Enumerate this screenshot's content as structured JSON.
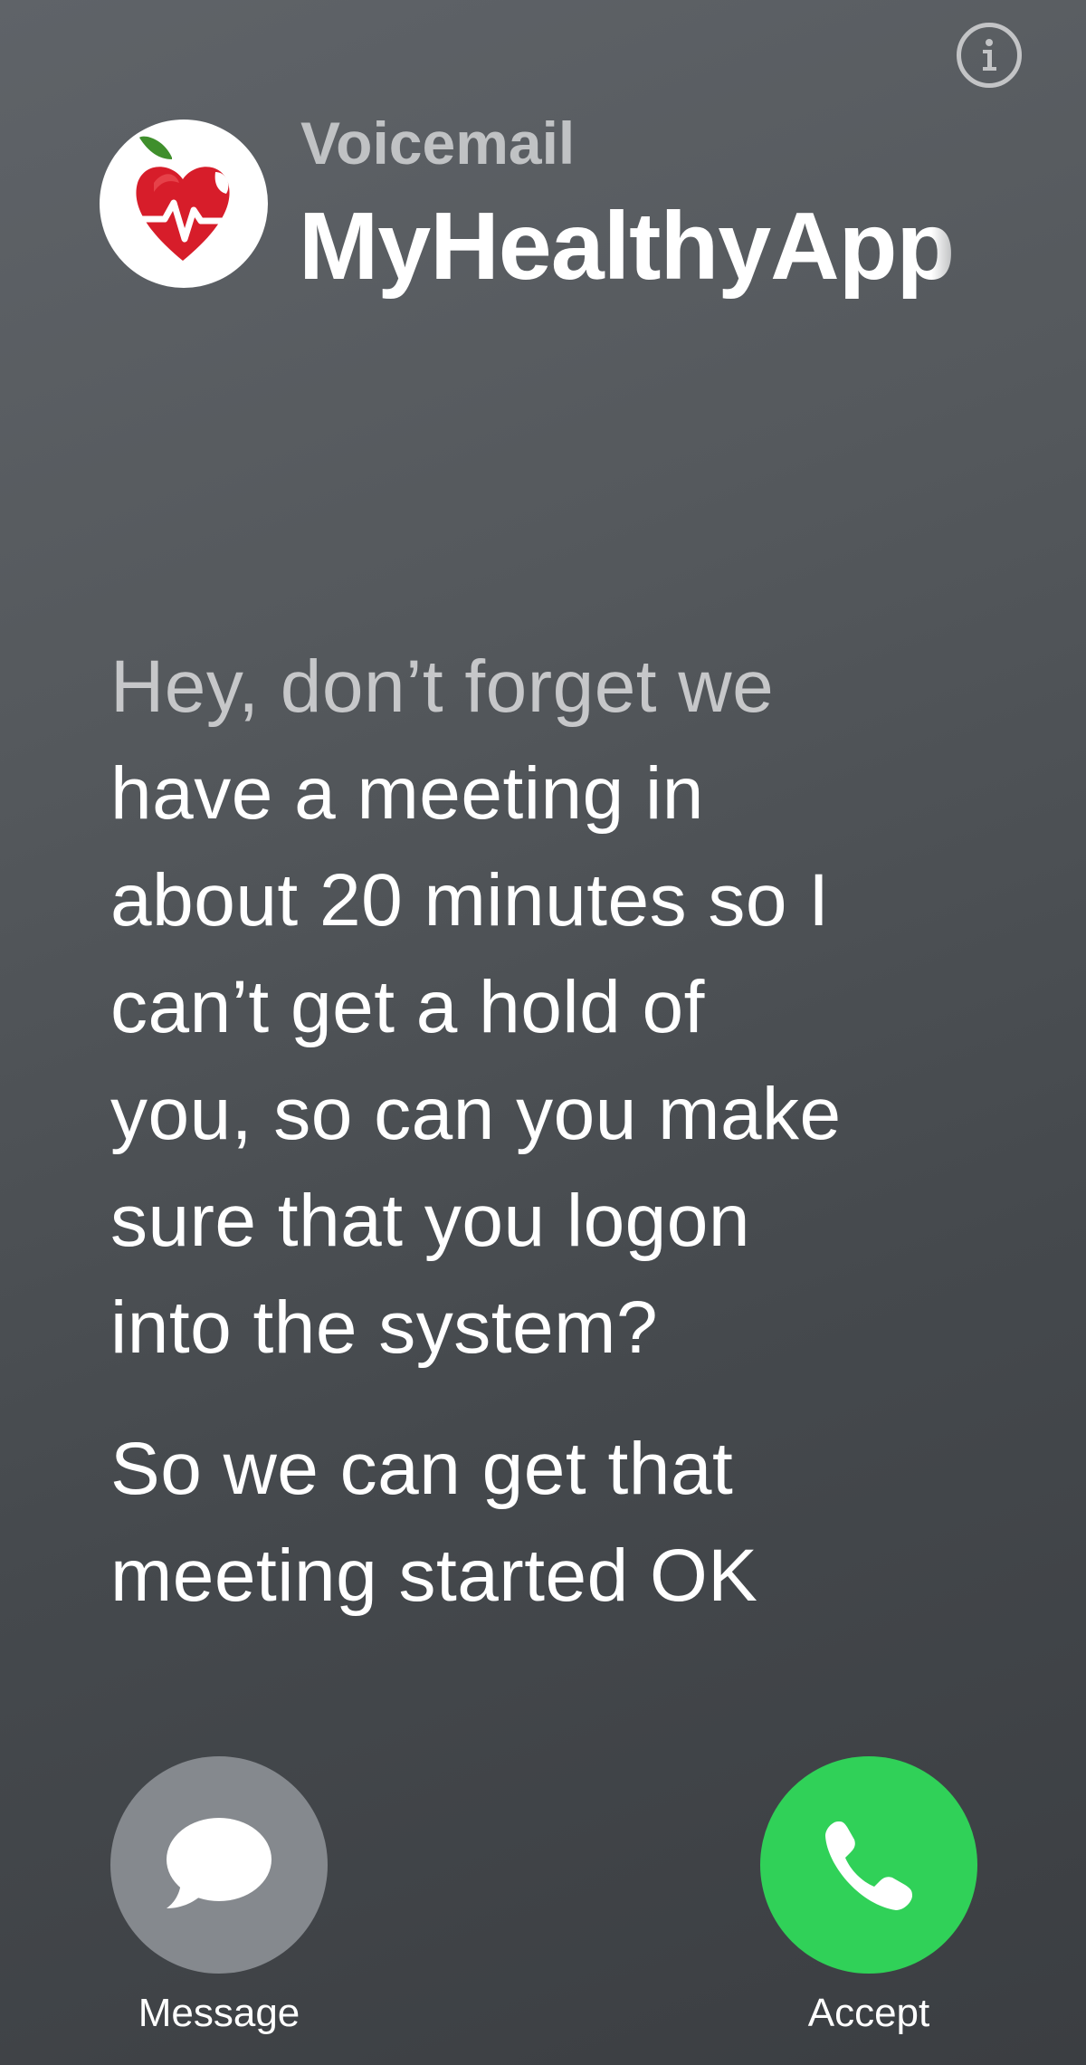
{
  "header": {
    "subtitle": "Voicemail",
    "caller_name": "MyHealthyApp"
  },
  "icons": {
    "info": "info-circle-icon",
    "avatar": "apple-heart-pulse-logo",
    "message": "speech-bubble-icon",
    "accept": "phone-handset-icon"
  },
  "transcript": {
    "paragraph_1_faded": "Hey, don’t forget we",
    "paragraph_1_lines": [
      "have a meeting in",
      "about 20 minutes so I",
      "can’t get a hold of",
      "you, so can you make",
      "sure that you logon",
      "into the system?"
    ],
    "paragraph_2_lines": [
      "So we can get that",
      "meeting started OK"
    ]
  },
  "actions": {
    "message_label": "Message",
    "accept_label": "Accept"
  },
  "colors": {
    "accept_green": "#30d158",
    "message_gray": "#85898e",
    "background_top": "#5f6368",
    "background_bottom": "#3b3e42",
    "logo_red": "#d71d2a"
  }
}
